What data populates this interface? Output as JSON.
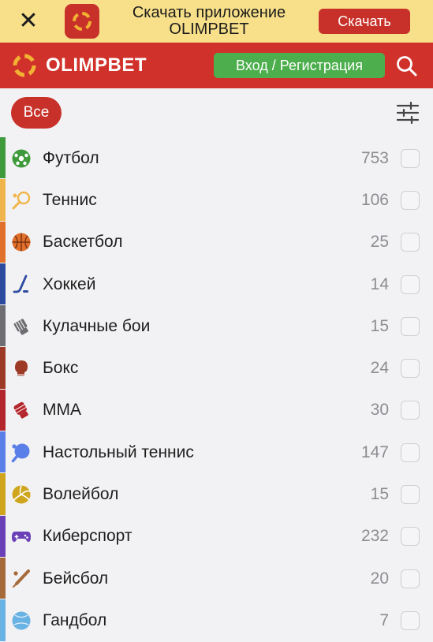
{
  "banner": {
    "close_label": "✕",
    "text_line1": "Скачать приложение",
    "text_line2": "OLIMPBET",
    "download_label": "Скачать"
  },
  "header": {
    "logo_text": "OLIMPBET",
    "login_label": "Вход / Регистрация",
    "search_icon": "search-icon"
  },
  "filter": {
    "all_label": "Все",
    "settings_icon": "sliders-icon"
  },
  "sports": [
    {
      "name": "Футбол",
      "count": "753",
      "color": "#3f9a3c",
      "icon": "football-icon"
    },
    {
      "name": "Теннис",
      "count": "106",
      "color": "#f0b54a",
      "icon": "tennis-icon"
    },
    {
      "name": "Баскетбол",
      "count": "25",
      "color": "#e0702b",
      "icon": "basketball-icon"
    },
    {
      "name": "Хоккей",
      "count": "14",
      "color": "#2b4aa0",
      "icon": "hockey-icon"
    },
    {
      "name": "Кулачные бои",
      "count": "15",
      "color": "#6e6e72",
      "icon": "fist-icon"
    },
    {
      "name": "Бокс",
      "count": "24",
      "color": "#9c3a26",
      "icon": "boxing-glove-icon"
    },
    {
      "name": "MMA",
      "count": "30",
      "color": "#b2262c",
      "icon": "mma-glove-icon"
    },
    {
      "name": "Настольный теннис",
      "count": "147",
      "color": "#5b7fe8",
      "icon": "table-tennis-icon"
    },
    {
      "name": "Волейбол",
      "count": "15",
      "color": "#cfa51e",
      "icon": "volleyball-icon"
    },
    {
      "name": "Киберспорт",
      "count": "232",
      "color": "#6a3fb8",
      "icon": "gamepad-icon"
    },
    {
      "name": "Бейсбол",
      "count": "20",
      "color": "#a66a3a",
      "icon": "baseball-icon"
    },
    {
      "name": "Гандбол",
      "count": "7",
      "color": "#69b2e4",
      "icon": "handball-icon"
    }
  ]
}
